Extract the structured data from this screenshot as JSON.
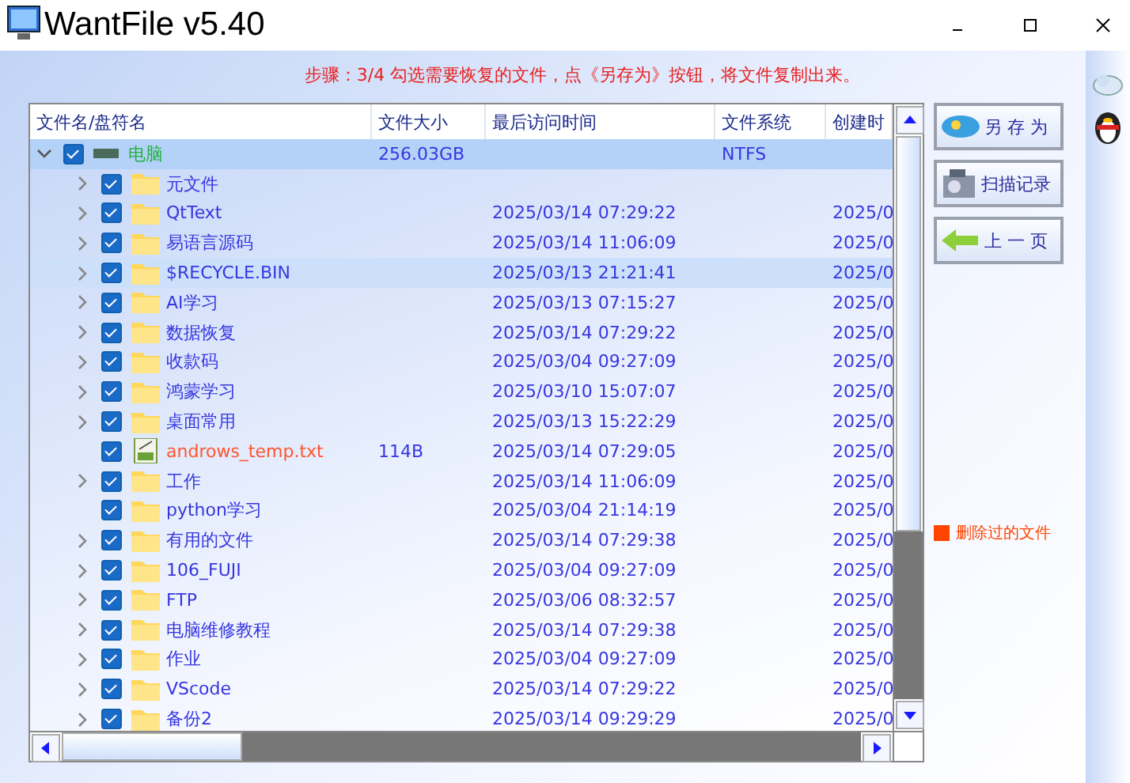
{
  "window": {
    "title": "WantFile v5.40"
  },
  "step_text": "步骤：3/4 勾选需要恢复的文件，点《另存为》按钮，将文件复制出来。",
  "table": {
    "columns": [
      "文件名/盘符名",
      "文件大小",
      "最后访问时间",
      "文件系统",
      "创建时"
    ],
    "root": {
      "name": "电脑",
      "size": "256.03GB",
      "file_system": "NTFS",
      "checked": true,
      "expanded": true,
      "selected": true
    },
    "rows": [
      {
        "kind": "folder",
        "name": "元文件",
        "size": "",
        "accessed": "",
        "created": "",
        "checked": true,
        "expandable": true,
        "deleted": false,
        "selected": false,
        "hovered": false
      },
      {
        "kind": "folder",
        "name": "QtText",
        "size": "",
        "accessed": "2025/03/14 07:29:22",
        "created": "2025/0",
        "checked": true,
        "expandable": true,
        "deleted": false,
        "selected": false,
        "hovered": false
      },
      {
        "kind": "folder",
        "name": "易语言源码",
        "size": "",
        "accessed": "2025/03/14 11:06:09",
        "created": "2025/0",
        "checked": true,
        "expandable": true,
        "deleted": false,
        "selected": false,
        "hovered": false
      },
      {
        "kind": "folder",
        "name": "$RECYCLE.BIN",
        "size": "",
        "accessed": "2025/03/13 21:21:41",
        "created": "2025/0",
        "checked": true,
        "expandable": true,
        "deleted": false,
        "selected": false,
        "hovered": true
      },
      {
        "kind": "folder",
        "name": "AI学习",
        "size": "",
        "accessed": "2025/03/13 07:15:27",
        "created": "2025/0",
        "checked": true,
        "expandable": true,
        "deleted": false,
        "selected": false,
        "hovered": false
      },
      {
        "kind": "folder",
        "name": "数据恢复",
        "size": "",
        "accessed": "2025/03/14 07:29:22",
        "created": "2025/0",
        "checked": true,
        "expandable": true,
        "deleted": false,
        "selected": false,
        "hovered": false
      },
      {
        "kind": "folder",
        "name": "收款码",
        "size": "",
        "accessed": "2025/03/04 09:27:09",
        "created": "2025/0",
        "checked": true,
        "expandable": true,
        "deleted": false,
        "selected": false,
        "hovered": false
      },
      {
        "kind": "folder",
        "name": "鸿蒙学习",
        "size": "",
        "accessed": "2025/03/10 15:07:07",
        "created": "2025/0",
        "checked": true,
        "expandable": true,
        "deleted": false,
        "selected": false,
        "hovered": false
      },
      {
        "kind": "folder",
        "name": "桌面常用",
        "size": "",
        "accessed": "2025/03/13 15:22:29",
        "created": "2025/0",
        "checked": true,
        "expandable": true,
        "deleted": false,
        "selected": false,
        "hovered": false
      },
      {
        "kind": "file",
        "name": "androws_temp.txt",
        "size": "114B",
        "accessed": "2025/03/14 07:29:05",
        "created": "2025/0",
        "checked": true,
        "expandable": false,
        "deleted": true,
        "selected": false,
        "hovered": false
      },
      {
        "kind": "folder",
        "name": "工作",
        "size": "",
        "accessed": "2025/03/14 11:06:09",
        "created": "2025/0",
        "checked": true,
        "expandable": true,
        "deleted": false,
        "selected": false,
        "hovered": false
      },
      {
        "kind": "folder",
        "name": "python学习",
        "size": "",
        "accessed": "2025/03/04 21:14:19",
        "created": "2025/0",
        "checked": true,
        "expandable": false,
        "deleted": false,
        "selected": false,
        "hovered": false
      },
      {
        "kind": "folder",
        "name": "有用的文件",
        "size": "",
        "accessed": "2025/03/14 07:29:38",
        "created": "2025/0",
        "checked": true,
        "expandable": true,
        "deleted": false,
        "selected": false,
        "hovered": false
      },
      {
        "kind": "folder",
        "name": "106_FUJI",
        "size": "",
        "accessed": "2025/03/04 09:27:09",
        "created": "2025/0",
        "checked": true,
        "expandable": true,
        "deleted": false,
        "selected": false,
        "hovered": false
      },
      {
        "kind": "folder",
        "name": "FTP",
        "size": "",
        "accessed": "2025/03/06 08:32:57",
        "created": "2025/0",
        "checked": true,
        "expandable": true,
        "deleted": false,
        "selected": false,
        "hovered": false
      },
      {
        "kind": "folder",
        "name": "电脑维修教程",
        "size": "",
        "accessed": "2025/03/14 07:29:38",
        "created": "2025/0",
        "checked": true,
        "expandable": true,
        "deleted": false,
        "selected": false,
        "hovered": false
      },
      {
        "kind": "folder",
        "name": "作业",
        "size": "",
        "accessed": "2025/03/04 09:27:09",
        "created": "2025/0",
        "checked": true,
        "expandable": true,
        "deleted": false,
        "selected": false,
        "hovered": false
      },
      {
        "kind": "folder",
        "name": "VScode",
        "size": "",
        "accessed": "2025/03/14 07:29:22",
        "created": "2025/0",
        "checked": true,
        "expandable": true,
        "deleted": false,
        "selected": false,
        "hovered": false
      },
      {
        "kind": "folder",
        "name": "备份2",
        "size": "",
        "accessed": "2025/03/14 09:29:29",
        "created": "2025/0",
        "checked": true,
        "expandable": true,
        "deleted": false,
        "selected": false,
        "hovered": false
      }
    ]
  },
  "buttons": [
    {
      "kind": "save",
      "label": "另 存 为"
    },
    {
      "kind": "scan",
      "label": "扫描记录"
    },
    {
      "kind": "back",
      "label": "上 一 页"
    }
  ],
  "legend": {
    "label": "删除过的文件",
    "color": "#ff4400"
  }
}
